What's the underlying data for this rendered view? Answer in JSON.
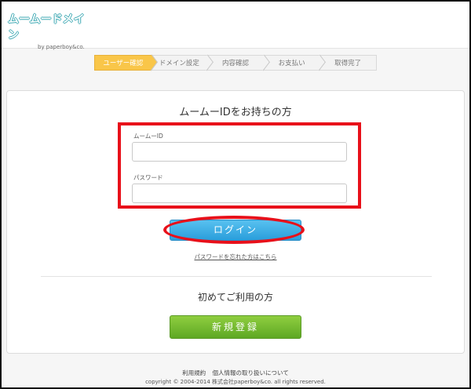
{
  "header": {
    "logo_text": "ムームードメイン",
    "logo_sub": "by paperboy&co."
  },
  "steps": [
    {
      "label": "ユーザー確認",
      "active": true
    },
    {
      "label": "ドメイン設定",
      "active": false
    },
    {
      "label": "内容確認",
      "active": false
    },
    {
      "label": "お支払い",
      "active": false
    },
    {
      "label": "取得完了",
      "active": false
    }
  ],
  "login": {
    "title": "ムームーIDをお持ちの方",
    "id_label": "ムームーID",
    "id_value": "",
    "password_label": "パスワード",
    "password_value": "",
    "button_label": "ログイン",
    "forgot_link": "パスワードを忘れた方はこちら"
  },
  "register": {
    "title": "初めてご利用の方",
    "button_label": "新規登録"
  },
  "footer": {
    "terms_link": "利用規約",
    "privacy_link": "個人情報の取り扱いについて",
    "copyright": "copyright © 2004-2014 株式会社paperboy&co. all rights reserved."
  },
  "colors": {
    "active_step": "#f9c649",
    "login_button": "#2a9edb",
    "register_button": "#5ea824",
    "annotation_red": "#e8101a"
  }
}
